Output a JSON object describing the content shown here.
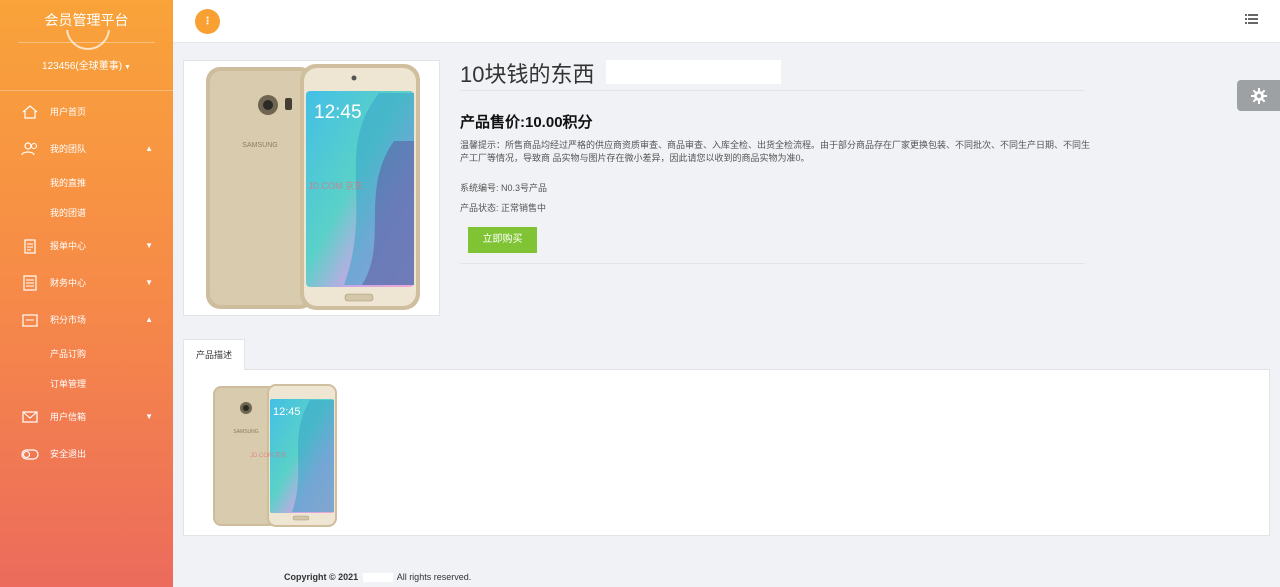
{
  "sidebar": {
    "brand": "会员管理平台",
    "user": "123456(全球董事)",
    "menu": [
      {
        "label": "用户首页",
        "icon": "home-icon",
        "expanded": false
      },
      {
        "label": "我的团队",
        "icon": "team-icon",
        "expanded": true,
        "children": [
          "我的直推",
          "我的团谱"
        ]
      },
      {
        "label": "报单中心",
        "icon": "clipboard-icon",
        "expanded": false
      },
      {
        "label": "财务中心",
        "icon": "finance-icon",
        "expanded": false
      },
      {
        "label": "积分市场",
        "icon": "store-icon",
        "expanded": true,
        "children": [
          "产品订购",
          "订单管理"
        ]
      },
      {
        "label": "用户信箱",
        "icon": "mail-icon",
        "expanded": false
      },
      {
        "label": "安全退出",
        "icon": "toggle-icon",
        "expanded": false
      }
    ]
  },
  "topbar": {
    "toggle_label": "⋮",
    "right_icon": "list-icon"
  },
  "product": {
    "title": "10块钱的东西",
    "price": "产品售价:10.00积分",
    "notice": "温馨提示：所售商品均经过严格的供应商资质审查、商品审查、入库全检、出货全检流程。由于部分商品存在厂家更换包装、不同批次、不同生产日期、不同生产工厂等情况，导致商 品实物与图片存在微小差异，因此请您以收到的商品实物为准0。",
    "system_no": "系统编号: N0.3号产品",
    "status": "产品状态: 正常销售中",
    "buy_label": "立即购买",
    "phone_time": "12:45",
    "phone_brand": "SAMSUNG",
    "watermark": "JD.COM 京东"
  },
  "tabs": {
    "active": "产品描述"
  },
  "footer": {
    "copyright_prefix": "Copyright © 2021",
    "copyright_suffix": "All rights reserved."
  },
  "colors": {
    "sidebar_top": "#f9a33a",
    "sidebar_bottom": "#ec6b5c",
    "buy_button": "#80c435",
    "toggle": "#f9a033"
  }
}
